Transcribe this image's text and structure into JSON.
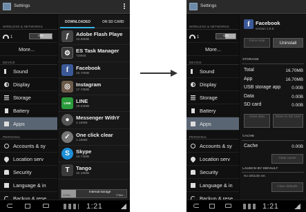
{
  "left": {
    "title": "Settings",
    "sidebar": {
      "sec_wireless": "WIRELESS & NETWORKS",
      "wifi_num": "1",
      "toggle_on": "ON",
      "more": "More...",
      "sec_device": "DEVICE",
      "sound": "Sound",
      "display": "Display",
      "storage": "Storage",
      "battery": "Battery",
      "apps": "Apps",
      "sec_personal": "PERSONAL",
      "accounts": "Accounts & sy",
      "location": "Location serv",
      "security": "Security",
      "language": "Language & in",
      "backup": "Backup & rese"
    },
    "tabs": {
      "downloaded": "DOWNLOADED",
      "on_sd": "ON SD CARD"
    },
    "apps": [
      {
        "name": "Adobe Flash Playe",
        "size": "12.86MB",
        "glyph": "ƒ",
        "cls": "flash"
      },
      {
        "name": "ES Task Manager",
        "size": "728KB",
        "glyph": "⚙",
        "cls": "es"
      },
      {
        "name": "Facebook",
        "size": "16.70MB",
        "glyph": "f",
        "cls": "fb"
      },
      {
        "name": "Instagram",
        "size": "17.78MB",
        "glyph": "◎",
        "cls": "ig"
      },
      {
        "name": "LINE",
        "size": "19.63MB",
        "glyph": "LINE",
        "cls": "line"
      },
      {
        "name": "Messenger WithY",
        "size": "4.16MB",
        "glyph": "●",
        "cls": "msg"
      },
      {
        "name": "One click clear",
        "size": "1.18MB",
        "glyph": "✓",
        "cls": "oc"
      },
      {
        "name": "Skype",
        "size": "16.74MB",
        "glyph": "S",
        "cls": "skype"
      },
      {
        "name": "Tango",
        "size": "32.19MB",
        "glyph": "T",
        "cls": "tango"
      }
    ],
    "storage": {
      "label": "Internal storage",
      "used": "232M...",
      "free": "775M...",
      "used_fraction": 0.22
    },
    "clock": "1:21"
  },
  "right": {
    "title": "Settings",
    "app_name": "Facebook",
    "version": "version 1.8.9",
    "force_stop": "Force stop",
    "uninstall": "Uninstall",
    "storage_header": "STORAGE",
    "storage_rows": [
      {
        "k": "Total",
        "v": "16.70MB"
      },
      {
        "k": "App",
        "v": "16.70MB"
      },
      {
        "k": "USB storage app",
        "v": "0.00B"
      },
      {
        "k": "Data",
        "v": "0.00B"
      },
      {
        "k": "SD card",
        "v": "0.00B"
      }
    ],
    "clear_data": "Clear data",
    "move_sd": "Move to SD card",
    "cache_header": "CACHE",
    "cache_k": "Cache",
    "cache_v": "0.00B",
    "clear_cache": "Clear cache",
    "launch_header": "LAUNCH BY DEFAULT",
    "no_defaults": "No defaults set.",
    "clear_defaults": "Clear defaults",
    "clock": "1:21"
  }
}
